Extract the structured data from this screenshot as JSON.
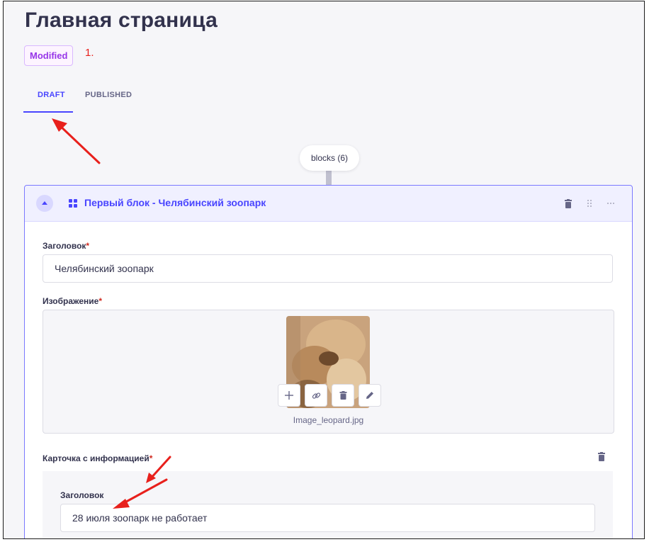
{
  "page": {
    "title": "Главная страница",
    "status_badge": "Modified",
    "annotation_number": "1."
  },
  "tabs": [
    {
      "label": "DRAFT",
      "active": true
    },
    {
      "label": "PUBLISHED",
      "active": false
    }
  ],
  "blocks_pill": "blocks (6)",
  "block": {
    "title": "Первый блок - Челябинский зоопарк",
    "fields": {
      "heading_label": "Заголовок",
      "heading_value": "Челябинский зоопарк",
      "image_label": "Изображение",
      "image_filename": "Image_leopard.jpg",
      "info_card_label": "Карточка с информацией",
      "nested_heading_label": "Заголовок",
      "nested_heading_value": "28 июля зоопарк не работает"
    },
    "required_mark": "*"
  },
  "colors": {
    "primary": "#4945ff",
    "badge_text": "#9736e8",
    "annotation_red": "#e8201c",
    "required": "#d02b20"
  },
  "icons": [
    "chevron-up-icon",
    "grid-icon",
    "trash-icon",
    "drag-handle-icon",
    "more-icon",
    "plus-icon",
    "link-icon",
    "edit-icon"
  ]
}
